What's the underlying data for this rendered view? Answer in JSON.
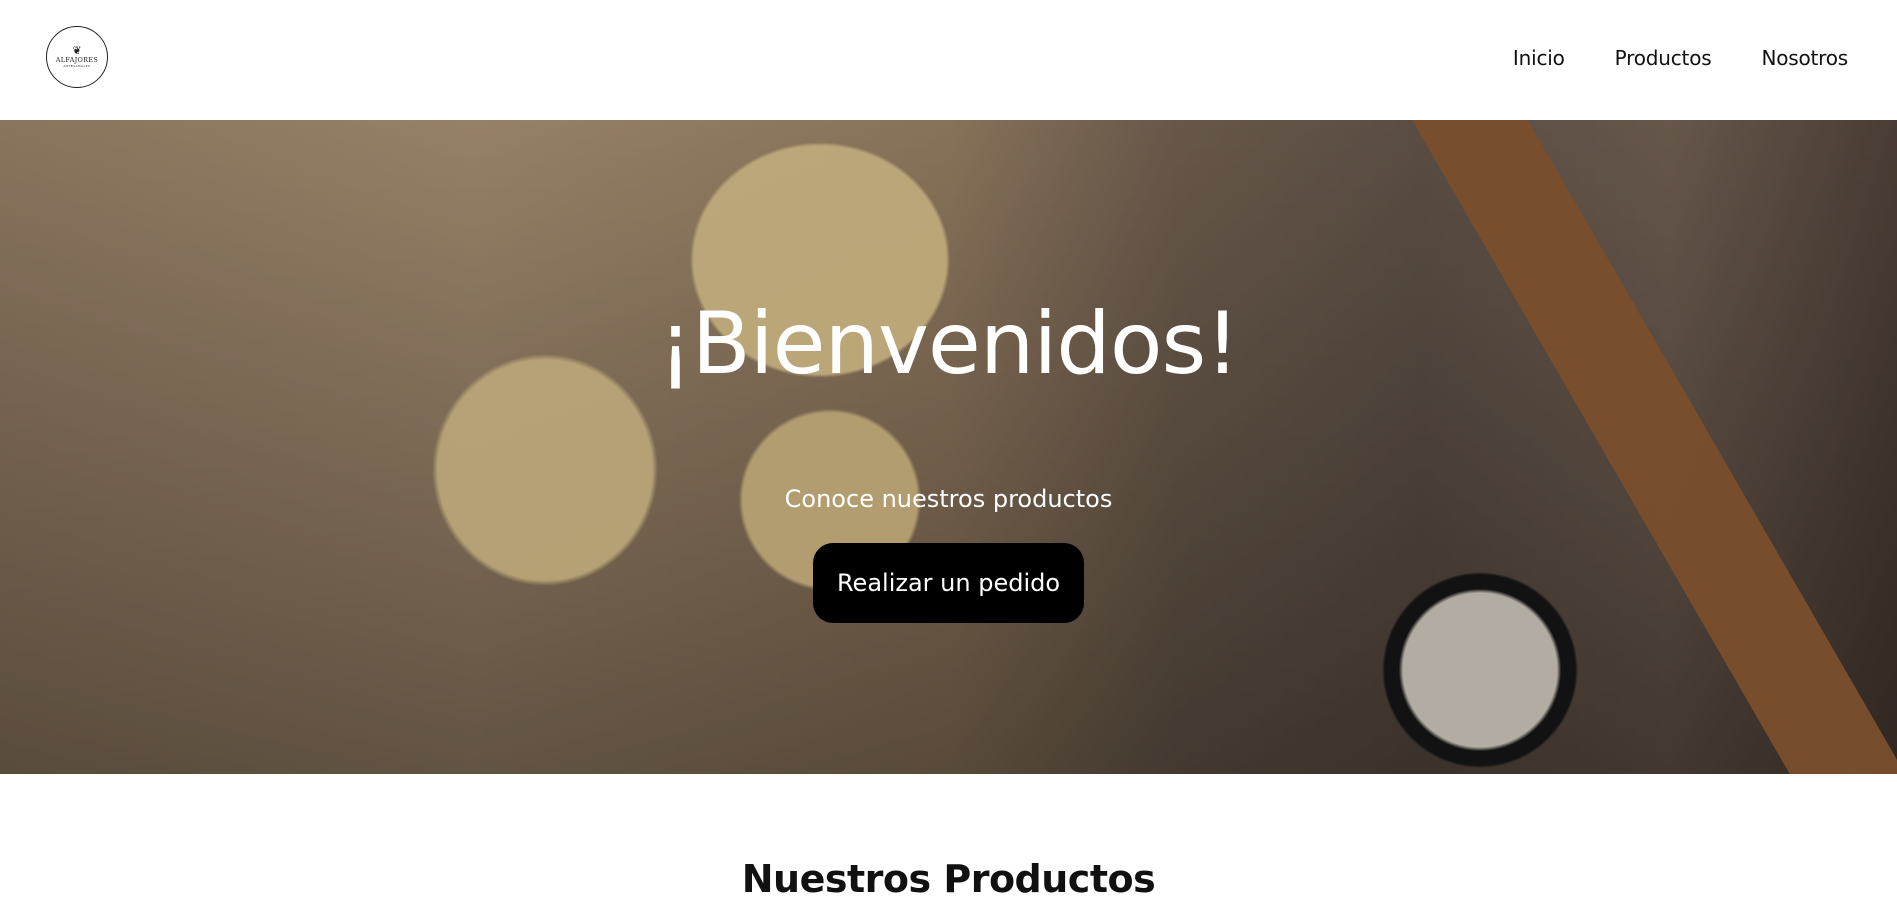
{
  "header": {
    "logo": {
      "icon": "whisk-icon",
      "name": "ALFAJORES",
      "sub": "ARTESANALES"
    },
    "nav": [
      "Inicio",
      "Productos",
      "Nosotros"
    ]
  },
  "hero": {
    "title": "¡Bienvenidos!",
    "subtitle": "Conoce nuestros productos",
    "button": "Realizar un pedido"
  },
  "products": {
    "title": "Nuestros Productos"
  },
  "colors": {
    "button_bg": "#000000",
    "text_light": "#ffffff",
    "text_dark": "#111111"
  }
}
